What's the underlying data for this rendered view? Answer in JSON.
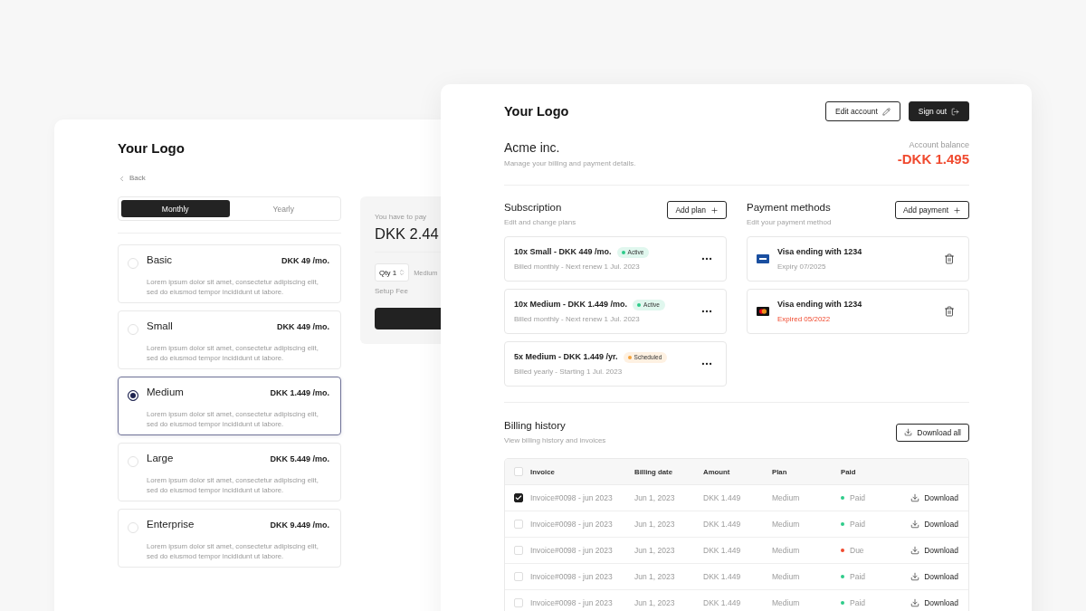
{
  "left_window": {
    "logo": "Your Logo",
    "back": "Back",
    "billing_toggle": [
      {
        "label": "Monthly",
        "selected": true
      },
      {
        "label": "Yearly",
        "selected": false
      }
    ],
    "plans": [
      {
        "name": "Basic",
        "price": "DKK 49 /mo.",
        "description": "Lorem ipsum dolor sit amet, consectetur adipiscing elit, sed do eiusmod tempor incididunt ut labore.",
        "selected": false
      },
      {
        "name": "Small",
        "price": "DKK 449 /mo.",
        "description": "Lorem ipsum dolor sit amet, consectetur adipiscing elit, sed do eiusmod tempor incididunt ut labore.",
        "selected": false
      },
      {
        "name": "Medium",
        "price": "DKK 1.449 /mo.",
        "description": "Lorem ipsum dolor sit amet, consectetur adipiscing elit, sed do eiusmod tempor incididunt ut labore.",
        "selected": true
      },
      {
        "name": "Large",
        "price": "DKK 5.449 /mo.",
        "description": "Lorem ipsum dolor sit amet, consectetur adipiscing elit, sed do eiusmod tempor incididunt ut labore.",
        "selected": false
      },
      {
        "name": "Enterprise",
        "price": "DKK 9.449 /mo.",
        "description": "Lorem ipsum dolor sit amet, consectetur adipiscing elit, sed do eiusmod tempor incididunt ut labore.",
        "selected": false
      }
    ],
    "summary": {
      "label": "You have to pay",
      "total": "DKK 2.44",
      "quantity": "Qty 1",
      "plan": "Medium",
      "setup_fee": "Setup Fee"
    }
  },
  "right_window": {
    "logo": "Your Logo",
    "edit_account": "Edit account",
    "sign_out": "Sign out",
    "account": {
      "name": "Acme inc.",
      "description": "Manage your billing and payment details.",
      "balance_label": "Account balance",
      "balance": "-DKK 1.495"
    },
    "subscription": {
      "title": "Subscription",
      "subtitle": "Edit and change plans",
      "add_button": "Add plan",
      "plans": [
        {
          "title": "10x Small - DKK 449 /mo.",
          "status": "Active",
          "color": "#2ecb8a",
          "detail": "Billed monthly - Next renew 1 Jul. 2023"
        },
        {
          "title": "10x Medium - DKK 1.449 /mo.",
          "status": "Active",
          "color": "#2ecb8a",
          "detail": "Billed monthly - Next renew 1 Jul. 2023"
        },
        {
          "title": "5x Medium - DKK 1.449 /yr.",
          "status": "Scheduled",
          "color": "#f5a23a",
          "detail": "Billed yearly - Starting 1 Jul. 2023"
        }
      ]
    },
    "payment_methods": {
      "title": "Payment methods",
      "subtitle": "Edit your payment method",
      "add_button": "Add payment",
      "cards": [
        {
          "kind": "visa",
          "name": "Visa ending with 1234",
          "expiry": "Expiry 07/2025",
          "expired": false
        },
        {
          "kind": "mastercard",
          "name": "Visa ending with 1234",
          "expiry": "Expired 05/2022",
          "expired": true
        }
      ]
    },
    "billing_history": {
      "title": "Billing history",
      "subtitle": "View billing history and invoices",
      "download_all": "Download all",
      "select_all_checked": false,
      "columns": [
        "Invoice",
        "Billing date",
        "Amount",
        "Plan",
        "Paid"
      ],
      "rows": [
        {
          "checked": true,
          "invoice": "Invoice#0098 - jun 2023",
          "date": "Jun 1, 2023",
          "amount": "DKK 1.449",
          "plan": "Medium",
          "status": "Paid",
          "color": "#2ecb8a",
          "action": "Download"
        },
        {
          "checked": false,
          "invoice": "Invoice#0098 - jun 2023",
          "date": "Jun 1, 2023",
          "amount": "DKK 1.449",
          "plan": "Medium",
          "status": "Paid",
          "color": "#2ecb8a",
          "action": "Download"
        },
        {
          "checked": false,
          "invoice": "Invoice#0098 - jun 2023",
          "date": "Jun 1, 2023",
          "amount": "DKK 1.449",
          "plan": "Medium",
          "status": "Due",
          "color": "#f04a2f",
          "action": "Download"
        },
        {
          "checked": false,
          "invoice": "Invoice#0098 - jun 2023",
          "date": "Jun 1, 2023",
          "amount": "DKK 1.449",
          "plan": "Medium",
          "status": "Paid",
          "color": "#2ecb8a",
          "action": "Download"
        },
        {
          "checked": false,
          "invoice": "Invoice#0098 - jun 2023",
          "date": "Jun 1, 2023",
          "amount": "DKK 1.449",
          "plan": "Medium",
          "status": "Paid",
          "color": "#2ecb8a",
          "action": "Download"
        }
      ]
    }
  }
}
